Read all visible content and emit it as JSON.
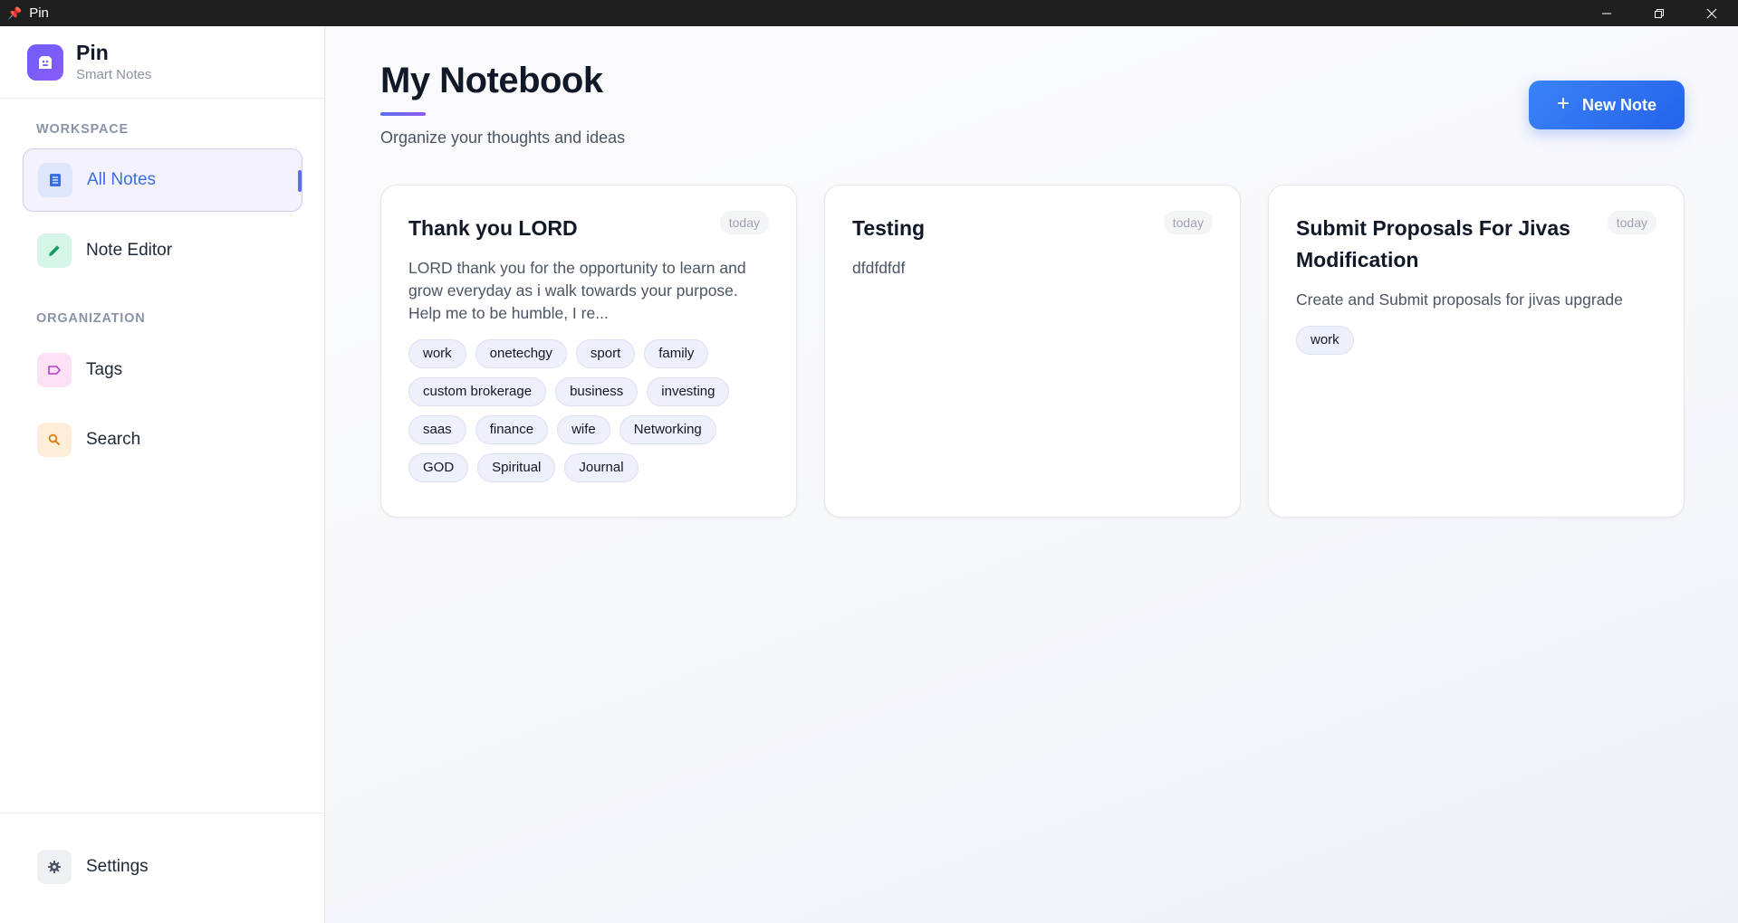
{
  "window": {
    "title": "Pin"
  },
  "brand": {
    "name": "Pin",
    "tagline": "Smart Notes"
  },
  "sidebar": {
    "workspace_label": "WORKSPACE",
    "organization_label": "ORGANIZATION",
    "items": [
      {
        "label": "All Notes",
        "icon": "notes-icon",
        "active": true
      },
      {
        "label": "Note Editor",
        "icon": "pencil-icon",
        "active": false
      },
      {
        "label": "Tags",
        "icon": "tag-icon",
        "active": false
      },
      {
        "label": "Search",
        "icon": "search-icon",
        "active": false
      }
    ],
    "settings_label": "Settings"
  },
  "header": {
    "title": "My Notebook",
    "subtitle": "Organize your thoughts and ideas",
    "new_note_label": "New Note"
  },
  "notes": [
    {
      "title": "Thank you LORD",
      "date": "today",
      "body": "LORD thank you for the opportunity to learn and grow everyday as i walk towards your purpose. Help me to be humble, I re...",
      "tags": [
        "work",
        "onetechgy",
        "sport",
        "family",
        "custom brokerage",
        "business",
        "investing",
        "saas",
        "finance",
        "wife",
        "Networking",
        "GOD",
        "Spiritual",
        "Journal"
      ]
    },
    {
      "title": "Testing",
      "date": "today",
      "body": "dfdfdfdf",
      "tags": []
    },
    {
      "title": "Submit Proposals For Jivas Modification",
      "date": "today",
      "body": "Create and Submit proposals for jivas upgrade",
      "tags": [
        "work"
      ]
    }
  ],
  "colors": {
    "accent": "#2563eb",
    "brand_purple": "#6d5dfc",
    "titlebar": "#1f1f1f"
  }
}
